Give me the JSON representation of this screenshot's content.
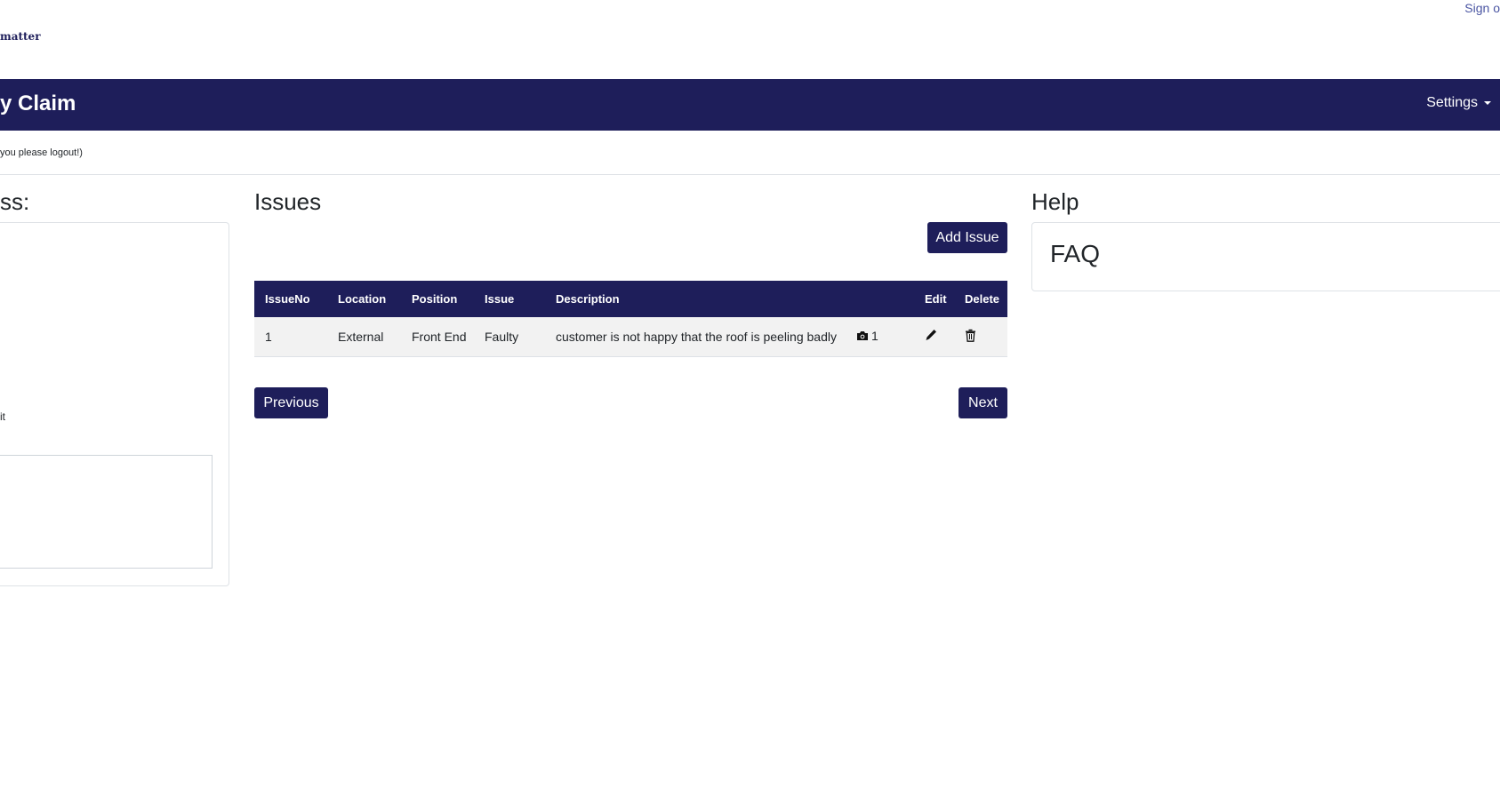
{
  "header": {
    "brand_text": "matter",
    "sign_out": "Sign o",
    "title": "y Claim",
    "settings_label": "Settings"
  },
  "notice": "you please logout!)",
  "left_panel": {
    "heading": "ss:",
    "text_fragment": "it"
  },
  "issues": {
    "heading": "Issues",
    "add_button": "Add Issue",
    "columns": [
      "IssueNo",
      "Location",
      "Position",
      "Issue",
      "Description",
      "",
      "Edit",
      "Delete"
    ],
    "rows": [
      {
        "issue_no": "1",
        "location": "External",
        "position": "Front End",
        "issue": "Faulty",
        "description": "customer is not happy that the roof is peeling badly",
        "photo_count": "1"
      }
    ],
    "prev_button": "Previous",
    "next_button": "Next"
  },
  "help": {
    "heading": "Help",
    "faq": "FAQ"
  },
  "icons": {
    "photos": "camera-icon",
    "edit": "pencil-icon",
    "delete": "trash-icon"
  },
  "colors": {
    "brand": "#1e1e5a",
    "link": "#4a55a2"
  }
}
